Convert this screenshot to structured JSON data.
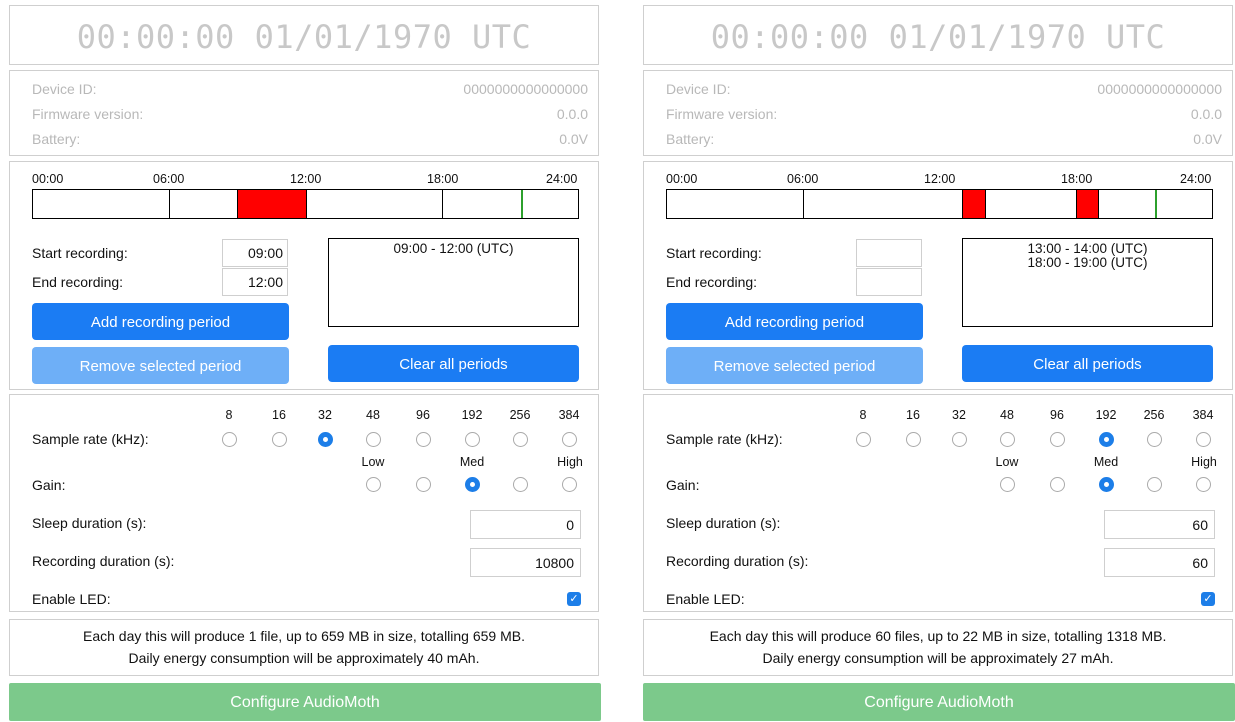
{
  "panels": [
    {
      "clock": "00:00:00 01/01/1970 UTC",
      "info": {
        "device_id_label": "Device ID:",
        "device_id": "0000000000000000",
        "firmware_label": "Firmware version:",
        "firmware": "0.0.0",
        "battery_label": "Battery:",
        "battery": "0.0V"
      },
      "timeline": {
        "labels": [
          "00:00",
          "06:00",
          "12:00",
          "18:00",
          "24:00"
        ],
        "periods": [
          {
            "start": 9,
            "end": 12
          }
        ],
        "now_hour": 21.5
      },
      "start_label": "Start recording:",
      "start_value": "09:00",
      "end_label": "End recording:",
      "end_value": "12:00",
      "period_list": [
        "09:00 - 12:00 (UTC)"
      ],
      "add_button": "Add recording period",
      "remove_button": "Remove selected period",
      "clear_button": "Clear all periods",
      "sample_rate_label": "Sample rate (kHz):",
      "sample_rates": [
        "8",
        "16",
        "32",
        "48",
        "96",
        "192",
        "256",
        "384"
      ],
      "sample_rate_selected": "32",
      "gain_label": "Gain:",
      "gain_levels": [
        "Low",
        "",
        "Med",
        "",
        "High"
      ],
      "gain_selected": 2,
      "sleep_label": "Sleep duration (s):",
      "sleep_value": "0",
      "rec_duration_label": "Recording duration (s):",
      "rec_duration_value": "10800",
      "led_label": "Enable LED:",
      "led_enabled": true,
      "summary_line1": "Each day this will produce 1 file, up to 659 MB in size, totalling 659 MB.",
      "summary_line2": "Daily energy consumption will be approximately 40 mAh.",
      "configure_button": "Configure AudioMoth"
    },
    {
      "clock": "00:00:00 01/01/1970 UTC",
      "info": {
        "device_id_label": "Device ID:",
        "device_id": "0000000000000000",
        "firmware_label": "Firmware version:",
        "firmware": "0.0.0",
        "battery_label": "Battery:",
        "battery": "0.0V"
      },
      "timeline": {
        "labels": [
          "00:00",
          "06:00",
          "12:00",
          "18:00",
          "24:00"
        ],
        "periods": [
          {
            "start": 13,
            "end": 14
          },
          {
            "start": 18,
            "end": 19
          }
        ],
        "now_hour": 21.5
      },
      "start_label": "Start recording:",
      "start_value": "",
      "end_label": "End recording:",
      "end_value": "",
      "period_list": [
        "13:00 - 14:00 (UTC)",
        "18:00 - 19:00 (UTC)"
      ],
      "add_button": "Add recording period",
      "remove_button": "Remove selected period",
      "clear_button": "Clear all periods",
      "sample_rate_label": "Sample rate (kHz):",
      "sample_rates": [
        "8",
        "16",
        "32",
        "48",
        "96",
        "192",
        "256",
        "384"
      ],
      "sample_rate_selected": "192",
      "gain_label": "Gain:",
      "gain_levels": [
        "Low",
        "",
        "Med",
        "",
        "High"
      ],
      "gain_selected": 2,
      "sleep_label": "Sleep duration (s):",
      "sleep_value": "60",
      "rec_duration_label": "Recording duration (s):",
      "rec_duration_value": "60",
      "led_label": "Enable LED:",
      "led_enabled": true,
      "summary_line1": "Each day this will produce 60 files, up to 22 MB in size, totalling 1318 MB.",
      "summary_line2": "Daily energy consumption will be approximately 27 mAh.",
      "configure_button": "Configure AudioMoth"
    }
  ]
}
